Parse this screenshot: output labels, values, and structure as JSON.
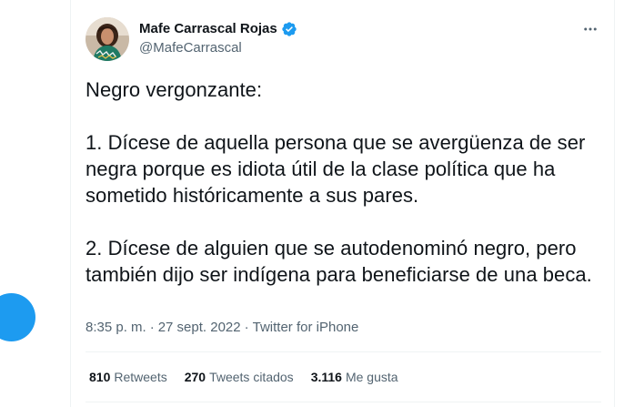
{
  "colors": {
    "accent": "#1d9bf0",
    "text_primary": "#0f1419",
    "text_secondary": "#536471",
    "divider": "#eff3f4"
  },
  "author": {
    "display_name": "Mafe Carrascal Rojas",
    "handle": "@MafeCarrascal",
    "verified": true,
    "avatar_icon": "profile-photo"
  },
  "tweet": {
    "text": "Negro vergonzante:\n\n1. Dícese de aquella persona que se avergüenza de ser negra porque es idiota útil de la clase política que ha sometido históricamente a sus pares.\n\n2. Dícese de alguien que se autodenominó negro, pero también dijo ser indígena para beneficiarse de una beca."
  },
  "meta": {
    "time": "8:35 p. m.",
    "separator1": "·",
    "date": "27 sept. 2022",
    "separator2": "·",
    "source": "Twitter for iPhone"
  },
  "stats": {
    "retweets": {
      "count": "810",
      "label": "Retweets"
    },
    "quotes": {
      "count": "270",
      "label": "Tweets citados"
    },
    "likes": {
      "count": "3.116",
      "label": "Me gusta"
    }
  },
  "icons": {
    "verified": "verified-badge-icon",
    "more": "more-horizontal-icon",
    "fab": "compose-fab-icon"
  }
}
